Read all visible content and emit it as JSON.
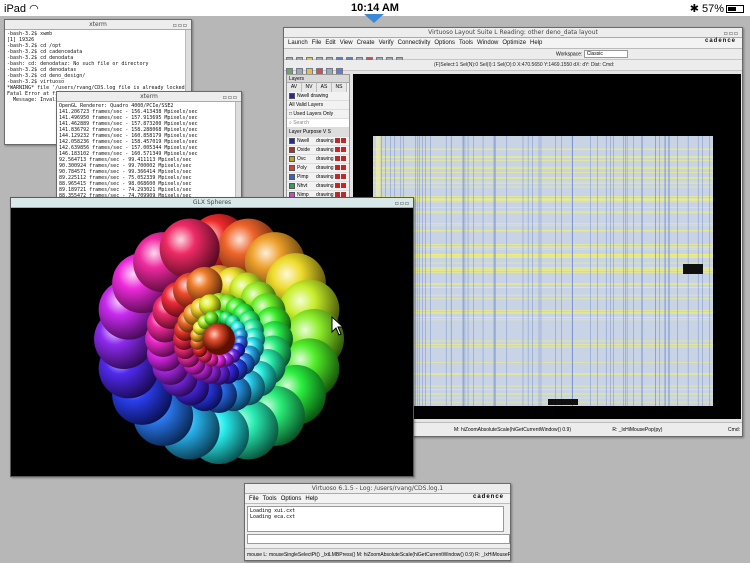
{
  "statusbar": {
    "device": "iPad",
    "time": "10:14 AM",
    "battery": "57%",
    "battery_level": 0.57
  },
  "term1": {
    "title": "xterm",
    "lines": [
      "-bash-3.2$ xwmb",
      "[1] 19326",
      "-bash-3.2$ cd /opt",
      "-bash-3.2$ cd cadencedata",
      "-bash-3.2$ cd denodata",
      "-bash: cd: denodataz: No such file or directory",
      "-bash-3.2$ cd denodatas",
      "-bash-3.2$ cd deno_design/",
      "-bash-3.2$ virtuoso",
      "*WARNING* file '/users/rvang/CDS.log file is already locked by some other process",
      "",
      "Fatal Error at file '/users/rvang/.VirtuosoRBE/.settings', line 1, column 1",
      "  Message: Invalid document structure"
    ]
  },
  "term2": {
    "title": "xterm",
    "lines": [
      "OpenGL Renderer: Quadro 4000/PCIe/SSE2",
      "141.206723 frames/sec - 156.413438 Mpixels/sec",
      "141.496950 frames/sec - 157.913695 Mpixels/sec",
      "141.462889 frames/sec - 157.873200 Mpixels/sec",
      "141.836792 frames/sec - 158.288068 Mpixels/sec",
      "144.129232 frames/sec - 160.858179 Mpixels/sec",
      "142.058236 frames/sec - 158.457019 Mpixels/sec",
      "142.639856 frames/sec - 157.005344 Mpixels/sec",
      "146.183102 frames/sec - 160.571349 Mpixels/sec",
      "92.564713 frames/sec - 99.411113 Mpixels/sec",
      "90.300924 frames/sec - 99.700002 Mpixels/sec",
      "90.784571 frames/sec - 99.366414 Mpixels/sec",
      "89.225112 frames/sec - 75.052339 Mpixels/sec",
      "88.965415 frames/sec - 98.068600 Mpixels/sec",
      "89.189721 frames/sec - 74.293021 Mpixels/sec",
      "88.355472 frames/sec - 74.709909 Mpixels/sec",
      "88.899960 frames/sec - 74.494975 Mpixels/sec",
      "88.304472 frames/sec - 69.023399 Mpixels/sec",
      "88.710338 frames/sec - 99.560860 Mpixels/sec",
      "88.778522 frames/sec - 98.022121 Mpixels/sec"
    ]
  },
  "glx": {
    "title": "GLX Spheres"
  },
  "virtuoso": {
    "title": "Virtuoso Layout Suite L Reading: other deno_data layout",
    "brand": "cadence",
    "menu": [
      "Launch",
      "File",
      "Edit",
      "View",
      "Create",
      "Verify",
      "Connectivity",
      "Options",
      "Tools",
      "Window",
      "Optimize",
      "Help"
    ],
    "workspace_label": "Workspace:",
    "workspace_value": "Classic",
    "coords": "(F)Select:1  Sel(N):0  Sel(I):1  Sel(O):0  X:470.5650  Y:1469.1550  dX:  dY:  Dist:  Cmd:",
    "layers": {
      "title": "Layers",
      "tabs": [
        "AV",
        "NV",
        "AS",
        "NS"
      ],
      "filter": "Nwell drawing",
      "valid": "All Valid Layers",
      "used": "Used Layers Only",
      "search": "Search",
      "header": "Layer Purpose  V  S",
      "rows": [
        {
          "name": "Nwell",
          "purpose": "drawing",
          "color": "#2a2a8a"
        },
        {
          "name": "Oxide",
          "purpose": "drawing",
          "color": "#aa3030"
        },
        {
          "name": "Ovc",
          "purpose": "drawing",
          "color": "#c0a020"
        },
        {
          "name": "Poly",
          "purpose": "drawing",
          "color": "#d04040"
        },
        {
          "name": "Pimp",
          "purpose": "drawing",
          "color": "#4060c0"
        },
        {
          "name": "Nhvt",
          "purpose": "drawing",
          "color": "#30a060"
        },
        {
          "name": "Nimp",
          "purpose": "drawing",
          "color": "#c050c0"
        },
        {
          "name": "Phvt",
          "purpose": "drawing",
          "color": "#9060c0"
        },
        {
          "name": "Nlvt",
          "purpose": "drawing",
          "color": "#40a0c0"
        },
        {
          "name": "SiProt",
          "purpose": "drawing",
          "color": "#b08040"
        }
      ]
    },
    "status_left": "M: hiZoomAbsoluteScale(hiGetCurrentWindow() 0.9)",
    "status_right": "R: _lxHiMousePop(py)",
    "cmd": "Cmd:"
  },
  "log": {
    "title": "Virtuoso 6.1.5 - Log: /users/rvang/CDS.log.1",
    "brand": "cadence",
    "menu": [
      "File",
      "Tools",
      "Options",
      "Help"
    ],
    "lines": [
      "Loading xui.cxt",
      "Loading eca.cxt"
    ],
    "status": "mouse L: mouseSingleSelectPt() _lxtLMBPress()     M: hiZoomAbsoluteScale(hiGetCurrentWindow() 0.9)   R: _lxHiMousePop(py)"
  }
}
